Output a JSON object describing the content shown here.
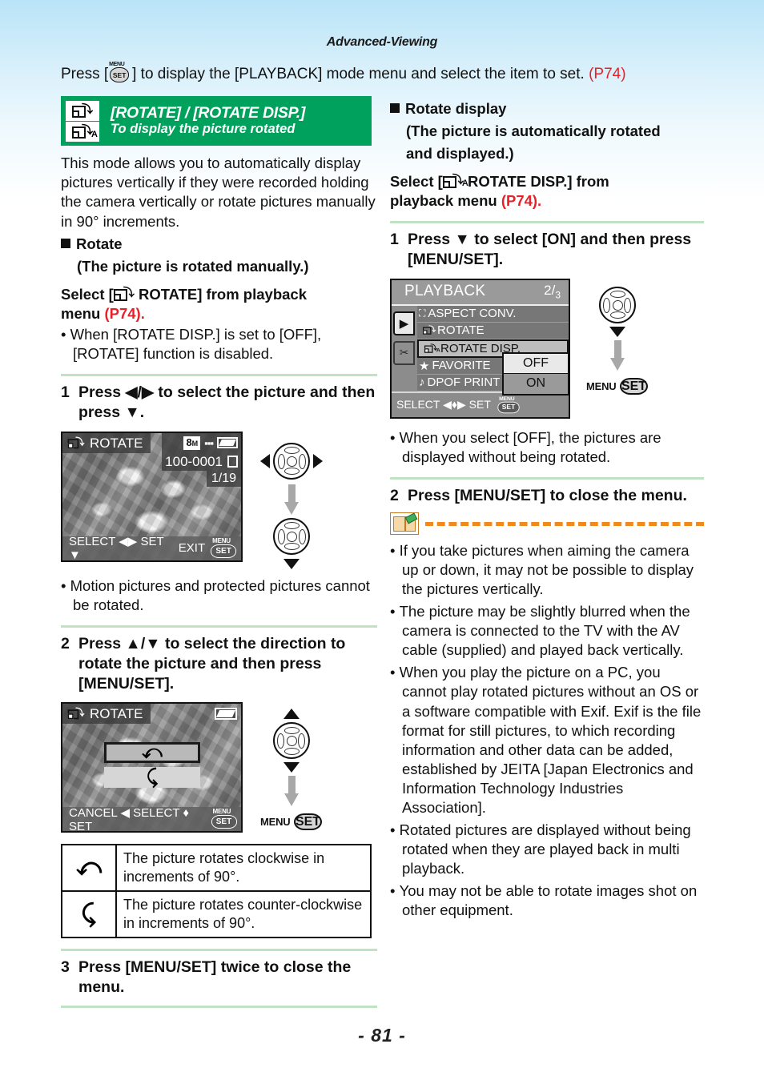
{
  "header": {
    "chapter": "Advanced-Viewing",
    "intro_before": "Press [",
    "intro_after": "] to display the [PLAYBACK] mode menu and select the item to set.",
    "intro_ref": "(P74)",
    "menu_label": "MENU",
    "set_label": "SET"
  },
  "banner": {
    "title": "[ROTATE] / [ROTATE DISP.]",
    "subtitle": "To display the picture rotated",
    "icon1": "rotate-icon",
    "icon2": "rotate-auto-icon",
    "color": "#00a15c"
  },
  "left": {
    "intro": "This mode allows you to automatically display pictures vertically if they were recorded holding the camera vertically or rotate pictures manually in 90° increments.",
    "rotate_head": "Rotate",
    "rotate_sub": "(The picture is rotated manually.)",
    "select_a": "Select [",
    "select_b": " ROTATE] from playback",
    "select_c": "menu ",
    "select_ref": "(P74).",
    "note1": "When [ROTATE DISP.] is set to [OFF], [ROTATE] function is disabled.",
    "step1_num": "1",
    "step1_text": "Press ◀/▶ to select the picture and then press ▼.",
    "note2": "Motion pictures and protected pictures cannot be rotated.",
    "step2_num": "2",
    "step2_text": "Press ▲/▼ to select the direction to rotate the picture and then press [MENU/SET].",
    "step3_num": "3",
    "step3_text": "Press [MENU/SET] twice to close the menu.",
    "table": [
      {
        "icon": "rotate-clockwise-arrow-icon",
        "desc": "The picture rotates clockwise in increments of 90°."
      },
      {
        "icon": "rotate-counter-clockwise-arrow-icon",
        "desc": "The picture rotates counter-clockwise in increments of 90°."
      }
    ]
  },
  "lcd1": {
    "title": "ROTATE",
    "resolution": "8",
    "resolution_unit": "M",
    "quality_icon": "quality-fine-icon",
    "battery_icon": "battery-icon",
    "file_number": "100-0001",
    "card_icon": "card-icon",
    "counter": "1/19",
    "bar_left": "SELECT ◀▶  SET ▼",
    "bar_right": "EXIT",
    "menu_label": "MENU",
    "set_label": "SET"
  },
  "lcd2": {
    "title": "ROTATE",
    "battery_icon": "battery-icon",
    "option_selected": "clockwise-arrow-icon",
    "option_unselected": "counter-clockwise-arrow-icon",
    "bar_text": "CANCEL ◀   SELECT ♦   SET",
    "menu_label": "MENU",
    "set_label": "SET"
  },
  "right": {
    "rotate_disp_head": "Rotate display",
    "rotate_disp_sub1": "(The picture is automatically rotated",
    "rotate_disp_sub2": "and displayed.)",
    "select_a": "Select [",
    "select_b": " ROTATE DISP.] from",
    "select_c": "playback menu ",
    "select_ref": "(P74).",
    "step1_num": "1",
    "step1_text": "Press ▼ to select [ON] and then press [MENU/SET].",
    "note1": "When you select [OFF], the pictures are displayed without being rotated.",
    "step2_num": "2",
    "step2_text": "Press [MENU/SET] to close the menu.",
    "notes": [
      "If you take pictures when aiming the camera up or down, it may not be possible to display the pictures vertically.",
      "The picture may be slightly blurred when the camera is connected to the TV with the AV cable (supplied) and played back vertically.",
      "When you play the picture on a PC, you cannot play rotated pictures without an OS or a software compatible with Exif. Exif is the file format for still pictures, to which recording information and other data can be added, established by JEITA [Japan Electronics and Information Technology Industries Association].",
      "Rotated pictures are displayed without being rotated when they are played back in multi playback.",
      "You may not be able to rotate images shot on other equipment."
    ]
  },
  "playback_menu": {
    "title": "PLAYBACK",
    "page_current": "2",
    "page_total": "3",
    "items": [
      {
        "label": "ASPECT CONV.",
        "icon": "aspect-icon"
      },
      {
        "label": "ROTATE",
        "icon": "rotate-icon"
      },
      {
        "label": "ROTATE DISP.",
        "icon": "rotate-auto-icon"
      },
      {
        "label": "FAVORITE",
        "icon": "star-icon"
      },
      {
        "label": "DPOF PRINT",
        "icon": "dpof-icon"
      }
    ],
    "highlighted_index": 2,
    "options": [
      {
        "label": "OFF",
        "selected": false
      },
      {
        "label": "ON",
        "selected": true
      }
    ],
    "tab_play": "▶",
    "tab_setup": "🔧",
    "footer_text": "SELECT ◀♦▶   SET",
    "menu_label": "MENU",
    "set_label": "SET"
  },
  "buttons": {
    "menu_label": "MENU",
    "set_label": "SET"
  },
  "footer": {
    "page": "- 81 -"
  }
}
